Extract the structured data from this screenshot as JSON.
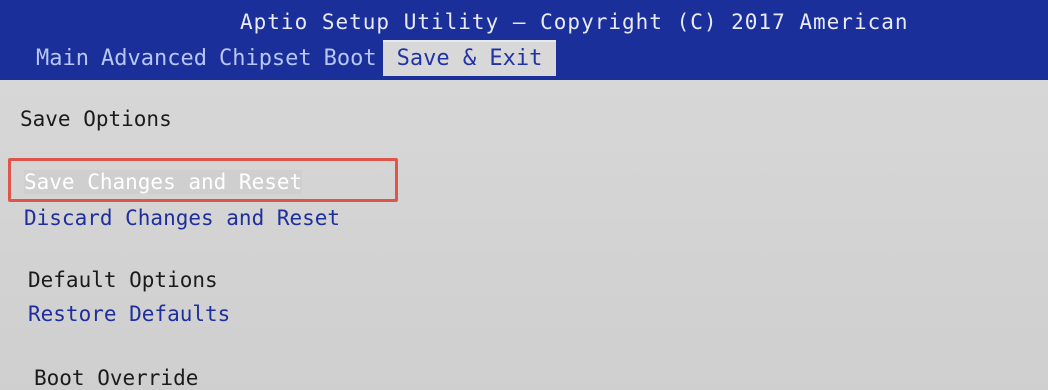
{
  "header": {
    "title": "Aptio Setup Utility – Copyright (C) 2017 American",
    "tabs": [
      "Main",
      "Advanced",
      "Chipset",
      "Boot",
      "Save & Exit"
    ],
    "active_tab": "Save & Exit"
  },
  "content": {
    "save_options_heading": "Save Options",
    "save_changes_reset": "Save Changes and Reset",
    "discard_changes_reset": "Discard Changes and Reset",
    "default_options_heading": "Default Options",
    "restore_defaults": "Restore Defaults",
    "boot_override_heading": "Boot Override"
  },
  "colors": {
    "header_blue": "#1a2f9a",
    "option_blue": "#1e2f9d",
    "highlight_red": "#e0554b",
    "background_gray": "#cfcfcf"
  }
}
